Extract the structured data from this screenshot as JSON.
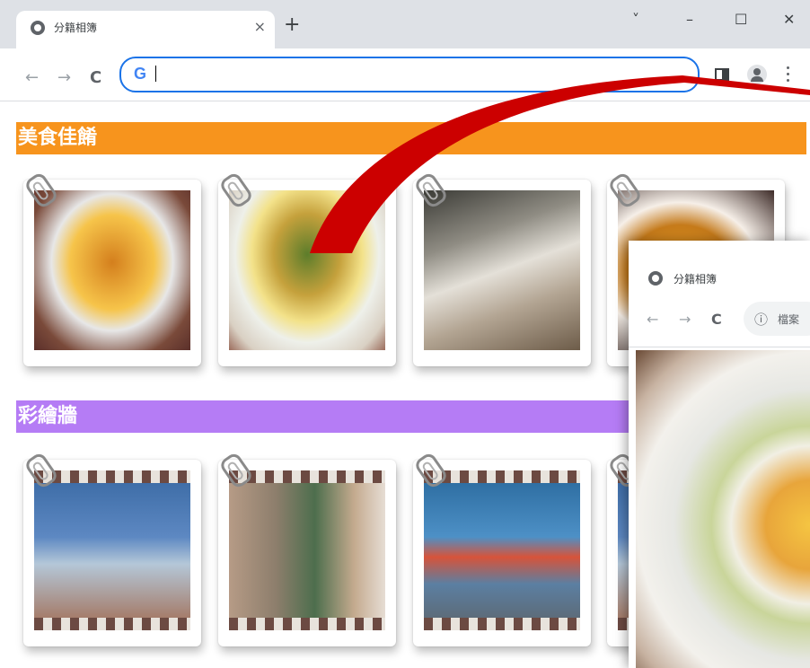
{
  "browser": {
    "tab_title": "分籍相簿",
    "tab_close": "×",
    "new_tab": "+",
    "window_controls": {
      "menu": "˅",
      "minimize": "–",
      "maximize": "☐",
      "close": "✕"
    },
    "nav": {
      "back": "←",
      "forward": "→",
      "reload": "C"
    },
    "omnibox": {
      "google_icon": "G",
      "value": ""
    },
    "toolbar_icons": [
      "side-panel-icon",
      "profile-icon",
      "more-menu-icon"
    ]
  },
  "sections": [
    {
      "title": "美食佳餚",
      "color": "#f7941d",
      "photos": [
        "food-photo-1",
        "food-photo-2",
        "food-photo-3",
        "food-photo-4"
      ]
    },
    {
      "title": "彩繪牆",
      "color": "#b57cf5",
      "photos": [
        "mural-photo-1",
        "mural-photo-2",
        "mural-photo-3",
        "mural-photo-4"
      ]
    }
  ],
  "popup": {
    "tab_title": "分籍相簿",
    "nav": {
      "back": "←",
      "forward": "→",
      "reload": "C"
    },
    "info_icon": "ⓘ",
    "address_text": "檔案"
  },
  "arrow_color": "#cc0000"
}
